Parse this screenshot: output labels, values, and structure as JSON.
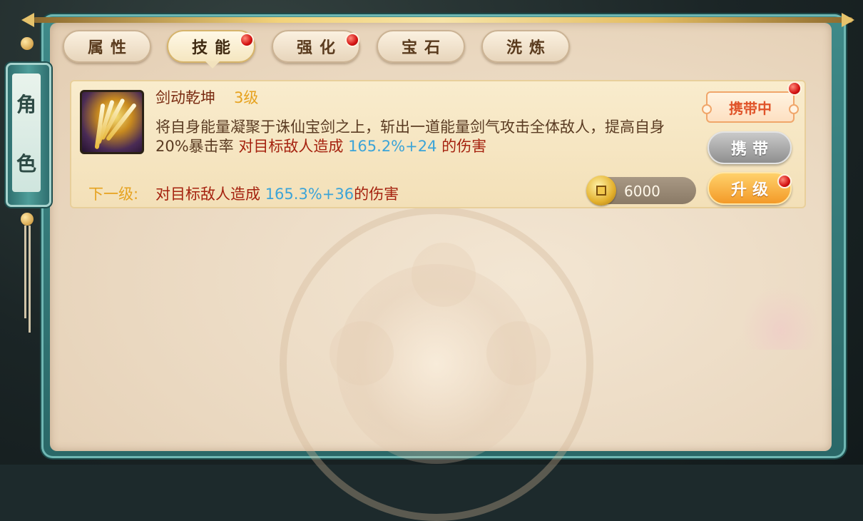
{
  "sidebar": {
    "role_chars": [
      "角",
      "色"
    ]
  },
  "tabs": [
    {
      "label": "属性",
      "active": false,
      "red_dot": false
    },
    {
      "label": "技能",
      "active": true,
      "red_dot": true
    },
    {
      "label": "强化",
      "active": false,
      "red_dot": true
    },
    {
      "label": "宝石",
      "active": false,
      "red_dot": false
    },
    {
      "label": "洗炼",
      "active": false,
      "red_dot": false
    }
  ],
  "skill": {
    "icon": "sword-energy-icon",
    "name": "剑动乾坤",
    "level": "3级",
    "desc_main": "将自身能量凝聚于诛仙宝剑之上，斩出一道能量剑气攻击全体敌人，提高自身20%暴击率",
    "desc_red": "对目标敌人造成",
    "desc_value": "165.2%+24",
    "desc_suffix": "的伤害",
    "next_label": "下一级:",
    "next_red": "对目标敌人造成",
    "next_value": "165.3%+36",
    "next_suffix": "的伤害"
  },
  "cost": {
    "icon": "gold-coin-icon",
    "value": "6000"
  },
  "badge": {
    "label": "携带中"
  },
  "buttons": {
    "carry_label": "携带",
    "upgrade_label": "升级"
  },
  "colors": {
    "accent_gold": "#e6a21f",
    "highlight_red": "#a5220f",
    "value_blue": "#3ca4d8",
    "frame_teal": "#3f8a89"
  }
}
